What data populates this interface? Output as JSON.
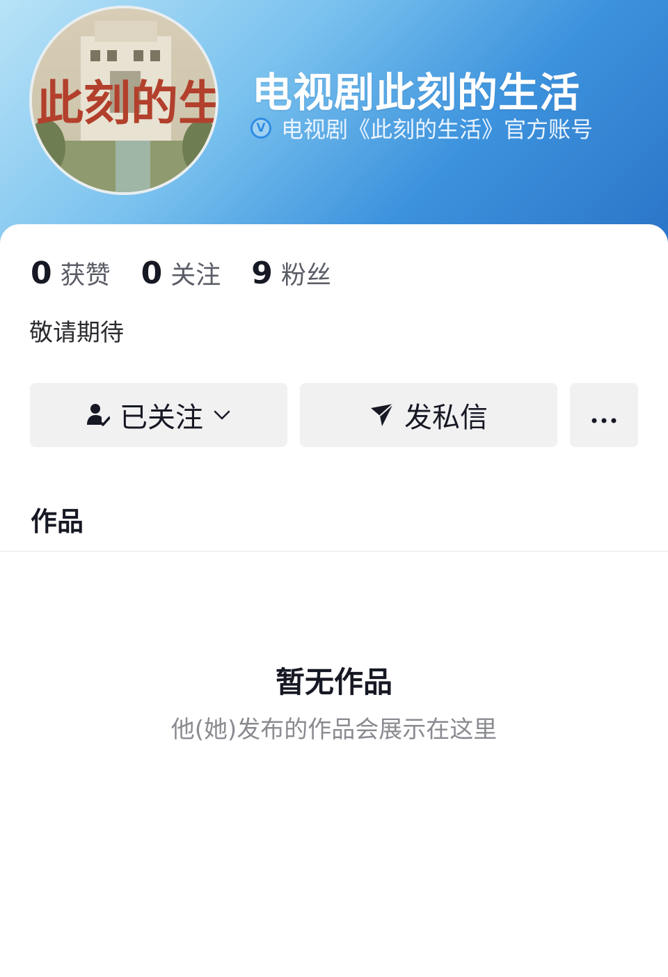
{
  "profile": {
    "avatar_text": "此刻的生活",
    "name": "电视剧此刻的生活",
    "verified_text": "电视剧《此刻的生活》官方账号",
    "bio": "敬请期待"
  },
  "stats": [
    {
      "num": "0",
      "label": "获赞"
    },
    {
      "num": "0",
      "label": "关注"
    },
    {
      "num": "9",
      "label": "粉丝"
    }
  ],
  "actions": {
    "follow_label": "已关注",
    "message_label": "发私信"
  },
  "tabs": {
    "works": "作品"
  },
  "empty": {
    "title": "暂无作品",
    "subtitle": "他(她)发布的作品会展示在这里"
  },
  "colors": {
    "header_start": "#b9e3f7",
    "header_end": "#2a72c6",
    "verify_blue": "#2f8ce3",
    "button_bg": "#f1f1f2"
  },
  "icons": {
    "verify": "verified-v-icon",
    "follow": "user-check-icon",
    "dropdown": "chevron-down-icon",
    "message": "paper-plane-icon",
    "more": "more-dots-icon"
  }
}
